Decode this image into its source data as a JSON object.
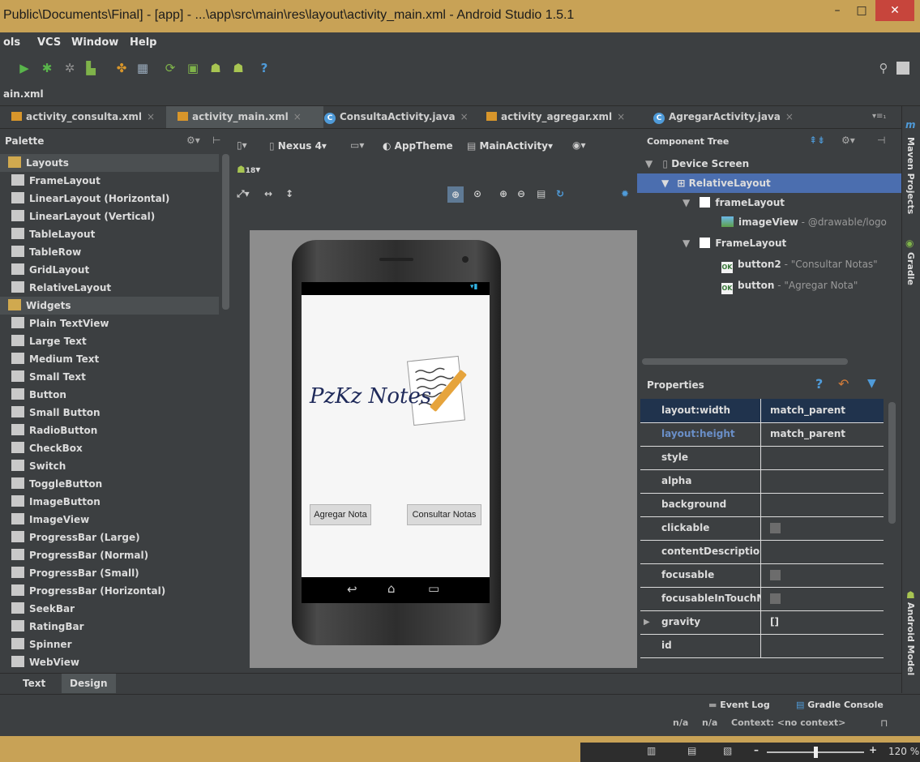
{
  "window": {
    "title": "Public\\Documents\\Final] - [app] - ...\\app\\src\\main\\res\\layout\\activity_main.xml - Android Studio 1.5.1",
    "min": "–",
    "max": "□",
    "close": "✕"
  },
  "menu": [
    "ols",
    "VCS",
    "Window",
    "Help"
  ],
  "nav": {
    "crumb": "ain.xml"
  },
  "tabs": [
    {
      "label": "activity_consulta.xml",
      "kind": "xml"
    },
    {
      "label": "activity_main.xml",
      "kind": "xml"
    },
    {
      "label": "ConsultaActivity.java",
      "kind": "java"
    },
    {
      "label": "activity_agregar.xml",
      "kind": "xml"
    },
    {
      "label": "AgregarActivity.java",
      "kind": "java"
    }
  ],
  "tab_close": "×",
  "tab_overflow": "▾≡₁",
  "palette": {
    "title": "Palette",
    "items": [
      {
        "label": "Layouts",
        "cat": true
      },
      {
        "label": "FrameLayout"
      },
      {
        "label": "LinearLayout (Horizontal)"
      },
      {
        "label": "LinearLayout (Vertical)"
      },
      {
        "label": "TableLayout"
      },
      {
        "label": "TableRow"
      },
      {
        "label": "GridLayout"
      },
      {
        "label": "RelativeLayout"
      },
      {
        "label": "Widgets",
        "cat": true
      },
      {
        "label": "Plain TextView"
      },
      {
        "label": "Large Text"
      },
      {
        "label": "Medium Text"
      },
      {
        "label": "Small Text"
      },
      {
        "label": "Button"
      },
      {
        "label": "Small Button"
      },
      {
        "label": "RadioButton"
      },
      {
        "label": "CheckBox"
      },
      {
        "label": "Switch"
      },
      {
        "label": "ToggleButton"
      },
      {
        "label": "ImageButton"
      },
      {
        "label": "ImageView"
      },
      {
        "label": "ProgressBar (Large)"
      },
      {
        "label": "ProgressBar (Normal)"
      },
      {
        "label": "ProgressBar (Small)"
      },
      {
        "label": "ProgressBar (Horizontal)"
      },
      {
        "label": "SeekBar"
      },
      {
        "label": "RatingBar"
      },
      {
        "label": "Spinner"
      },
      {
        "label": "WebView"
      }
    ]
  },
  "design_toolbar": {
    "device": "Nexus 4",
    "theme": "AppTheme",
    "activity": "MainActivity",
    "api": "18"
  },
  "app": {
    "title": "PzKz Notes",
    "button_left": "Agregar Nota",
    "button_right": "Consultar Notas"
  },
  "component_tree": {
    "title": "Component Tree",
    "rows": [
      {
        "label": "Device Screen",
        "sub": ""
      },
      {
        "label": "RelativeLayout",
        "sub": ""
      },
      {
        "label": "frameLayout",
        "sub": ""
      },
      {
        "label": "imageView",
        "sub": " - @drawable/logo"
      },
      {
        "label": "FrameLayout",
        "sub": ""
      },
      {
        "label": "button2",
        "sub": " - \"Consultar Notas\""
      },
      {
        "label": "button",
        "sub": " - \"Agregar Nota\""
      }
    ]
  },
  "properties": {
    "title": "Properties",
    "rows": [
      {
        "name": "layout:width",
        "value": "match_parent",
        "highlight": true
      },
      {
        "name": "layout:height",
        "value": "match_parent"
      },
      {
        "name": "style",
        "value": ""
      },
      {
        "name": "alpha",
        "value": ""
      },
      {
        "name": "background",
        "value": ""
      },
      {
        "name": "clickable",
        "check": true
      },
      {
        "name": "contentDescription",
        "value": ""
      },
      {
        "name": "focusable",
        "check": true
      },
      {
        "name": "focusableInTouchMode",
        "check": true
      },
      {
        "name": "gravity",
        "value": "[]",
        "expand": true
      },
      {
        "name": "id",
        "value": ""
      }
    ]
  },
  "side_tools": [
    "Maven Projects",
    "Gradle",
    "Android Model"
  ],
  "bottom_tabs": [
    "Text",
    "Design"
  ],
  "status": {
    "event_log": "Event Log",
    "gradle_console": "Gradle Console",
    "na1": "n/a",
    "na2": "n/a",
    "context": "Context: <no context>"
  },
  "zoom": "120 %",
  "colors": {
    "accent": "#4b6eaf",
    "title_bar": "#c8a256",
    "ide_bg": "#3c3f41"
  }
}
